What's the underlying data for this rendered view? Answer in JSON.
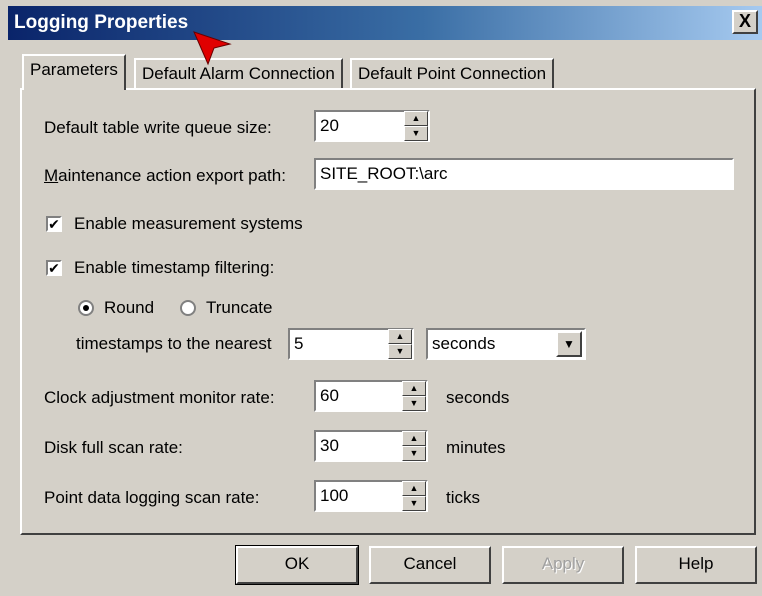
{
  "window": {
    "title": "Logging Properties",
    "close_glyph": "X"
  },
  "tabs": [
    {
      "label": "Parameters",
      "active": true
    },
    {
      "label": "Default Alarm Connection",
      "active": false
    },
    {
      "label": "Default Point Connection",
      "active": false
    }
  ],
  "params": {
    "queue_label": "Default table write queue size:",
    "queue_value": "20",
    "export_path_label": "Maintenance action export path:",
    "export_path_value": "SITE_ROOT:\\arc",
    "enable_measurement_label": "Enable measurement systems",
    "enable_measurement_checked": true,
    "enable_timestamp_label": "Enable timestamp filtering:",
    "enable_timestamp_checked": true,
    "round_label": "Round",
    "round_selected": true,
    "truncate_label": "Truncate",
    "nearest_label": "timestamps to the nearest",
    "nearest_value": "5",
    "nearest_unit": "seconds",
    "clock_label": "Clock adjustment monitor rate:",
    "clock_value": "60",
    "clock_unit": "seconds",
    "disk_label": "Disk full scan rate:",
    "disk_value": "30",
    "disk_unit": "minutes",
    "point_label": "Point data logging scan rate:",
    "point_value": "100",
    "point_unit": "ticks"
  },
  "buttons": {
    "ok": "OK",
    "cancel": "Cancel",
    "apply": "Apply",
    "help": "Help"
  },
  "icons": {
    "checkmark": "✔",
    "spin_up": "▲",
    "spin_down": "▼",
    "dropdown": "▼"
  },
  "colors": {
    "titlebar_start": "#0a246a",
    "titlebar_end": "#a6caf0",
    "face": "#d4d0c8",
    "cursor": "#e00000"
  }
}
